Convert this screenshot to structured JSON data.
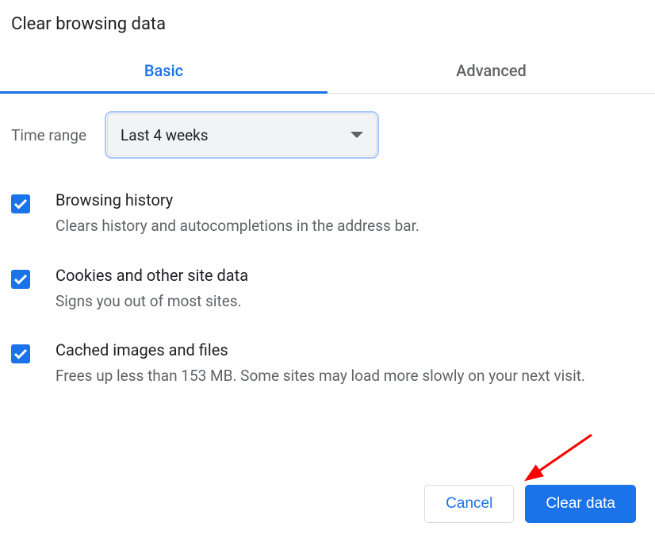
{
  "title": "Clear browsing data",
  "tabs": {
    "basic": "Basic",
    "advanced": "Advanced"
  },
  "timeRange": {
    "label": "Time range",
    "value": "Last 4 weeks"
  },
  "options": [
    {
      "title": "Browsing history",
      "desc": "Clears history and autocompletions in the address bar."
    },
    {
      "title": "Cookies and other site data",
      "desc": "Signs you out of most sites."
    },
    {
      "title": "Cached images and files",
      "desc": "Frees up less than 153 MB. Some sites may load more slowly on your next visit."
    }
  ],
  "buttons": {
    "cancel": "Cancel",
    "clear": "Clear data"
  }
}
